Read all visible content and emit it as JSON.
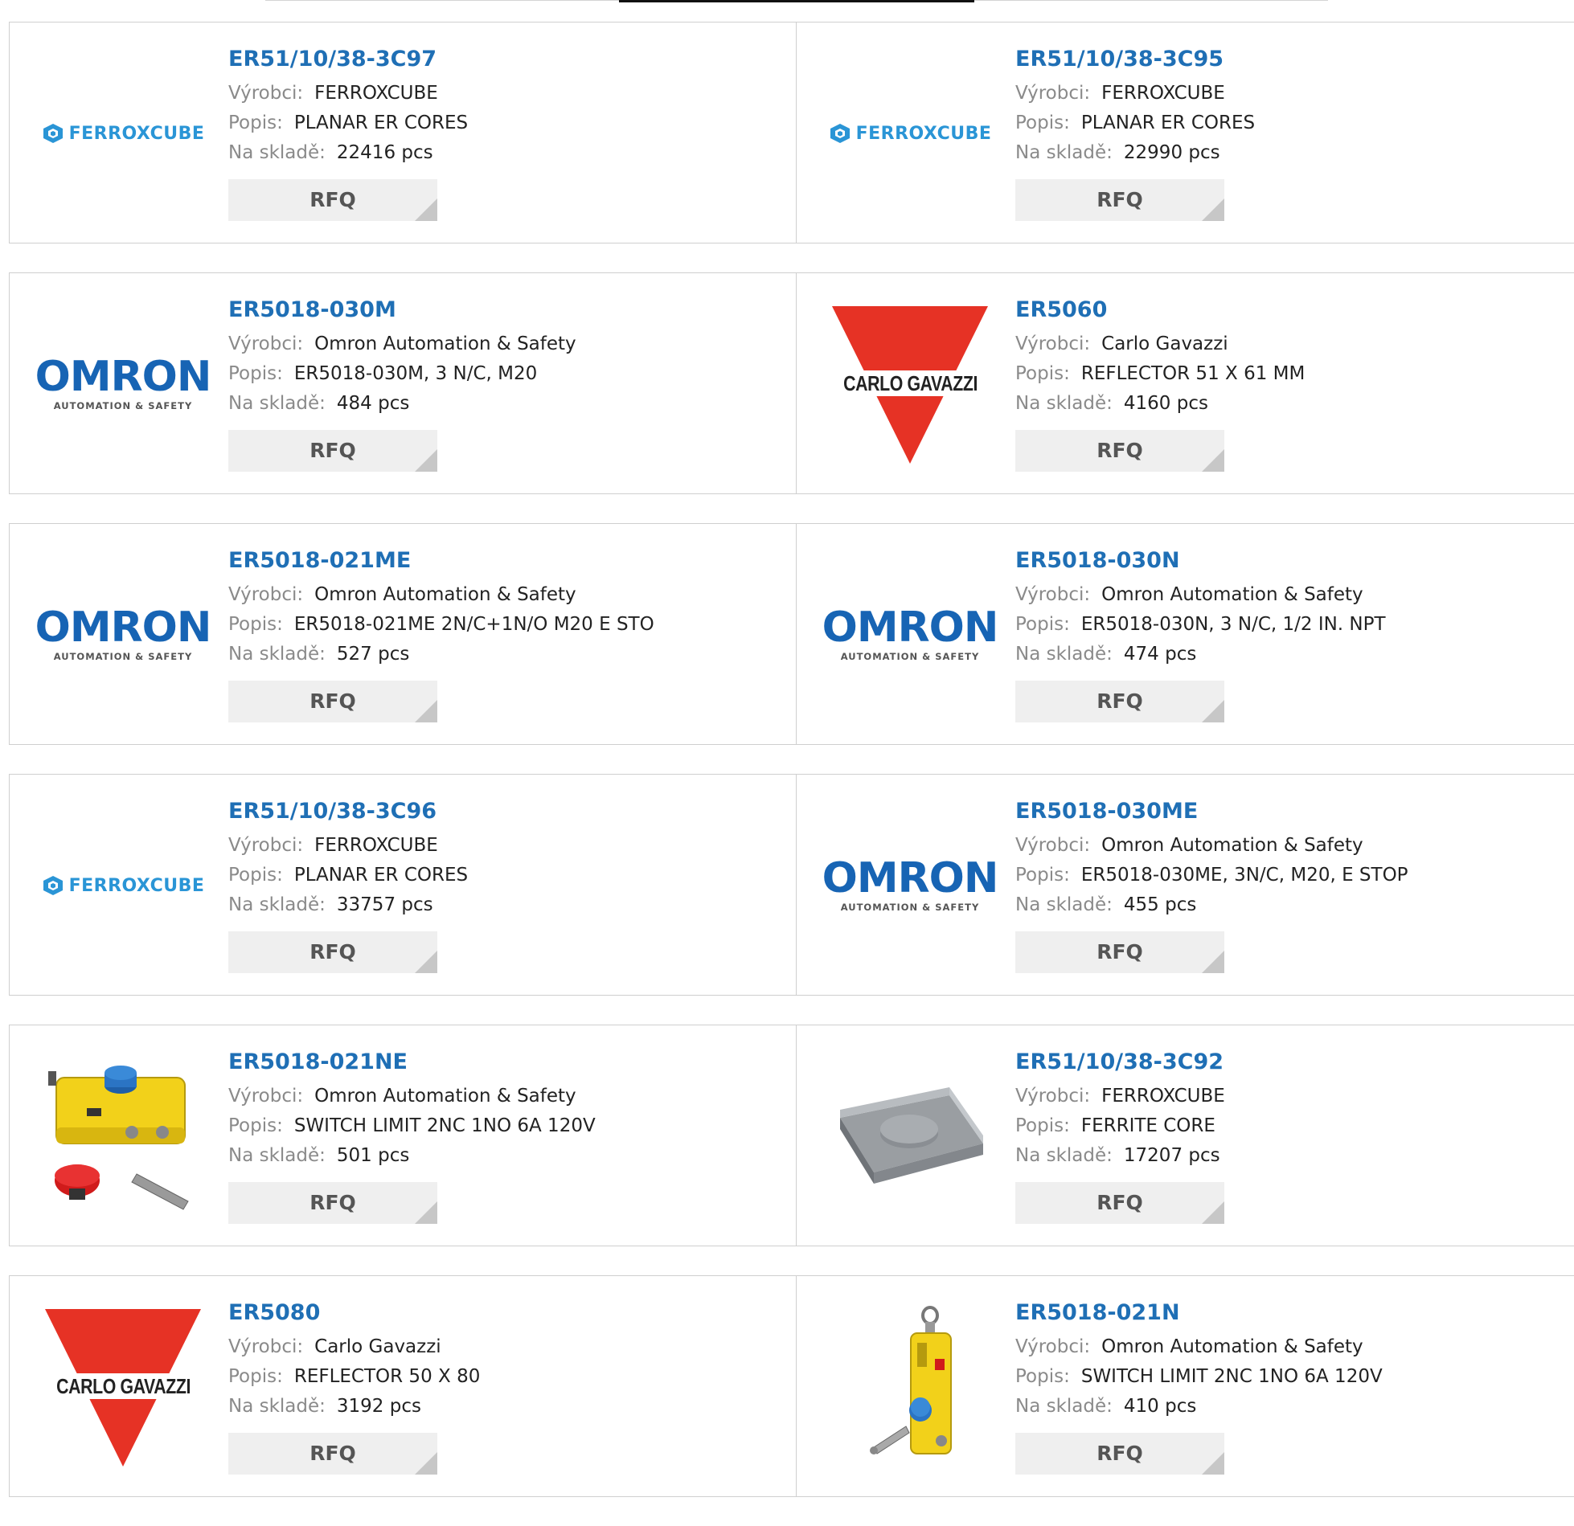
{
  "labels": {
    "manufacturer": "Výrobci:",
    "description": "Popis:",
    "stock": "Na skladě:",
    "rfq": "RFQ"
  },
  "brand_logos": {
    "ferroxcube": "FERROXCUBE",
    "omron": "OMRON",
    "omron_sub": "AUTOMATION & SAFETY",
    "carlo_gavazzi": "CARLO GAVAZZI"
  },
  "colors": {
    "link": "#1f6fb5",
    "ferroxcube_blue": "#2a95d6",
    "omron_blue": "#1764b4",
    "gavazzi_red": "#e63225",
    "rfq_bg": "#efefef"
  },
  "products": [
    {
      "pn": "ER51/10/38-3C97",
      "manufacturer": "FERROXCUBE",
      "description": "PLANAR ER CORES",
      "stock": "22416 pcs",
      "logo": "ferroxcube"
    },
    {
      "pn": "ER51/10/38-3C95",
      "manufacturer": "FERROXCUBE",
      "description": "PLANAR ER CORES",
      "stock": "22990 pcs",
      "logo": "ferroxcube"
    },
    {
      "pn": "ER5018-030M",
      "manufacturer": "Omron Automation & Safety",
      "description": "ER5018-030M, 3 N/C, M20",
      "stock": "484 pcs",
      "logo": "omron"
    },
    {
      "pn": "ER5060",
      "manufacturer": "Carlo Gavazzi",
      "description": "REFLECTOR 51 X 61 MM",
      "stock": "4160 pcs",
      "logo": "carlo-gavazzi"
    },
    {
      "pn": "ER5018-021ME",
      "manufacturer": "Omron Automation & Safety",
      "description": "ER5018-021ME 2N/C+1N/O M20 E STO",
      "stock": "527 pcs",
      "logo": "omron"
    },
    {
      "pn": "ER5018-030N",
      "manufacturer": "Omron Automation & Safety",
      "description": "ER5018-030N, 3 N/C, 1/2 IN. NPT",
      "stock": "474 pcs",
      "logo": "omron"
    },
    {
      "pn": "ER51/10/38-3C96",
      "manufacturer": "FERROXCUBE",
      "description": "PLANAR ER CORES",
      "stock": "33757 pcs",
      "logo": "ferroxcube"
    },
    {
      "pn": "ER5018-030ME",
      "manufacturer": "Omron Automation & Safety",
      "description": "ER5018-030ME, 3N/C, M20, E STOP",
      "stock": "455 pcs",
      "logo": "omron"
    },
    {
      "pn": "ER5018-021NE",
      "manufacturer": "Omron Automation & Safety",
      "description": "SWITCH LIMIT 2NC 1NO 6A 120V",
      "stock": "501 pcs",
      "logo": "switch-estop-photo"
    },
    {
      "pn": "ER51/10/38-3C92",
      "manufacturer": "FERROXCUBE",
      "description": "FERRITE CORE",
      "stock": "17207 pcs",
      "logo": "ferrite-core-photo"
    },
    {
      "pn": "ER5080",
      "manufacturer": "Carlo Gavazzi",
      "description": "REFLECTOR 50 X 80",
      "stock": "3192 pcs",
      "logo": "carlo-gavazzi"
    },
    {
      "pn": "ER5018-021N",
      "manufacturer": "Omron Automation & Safety",
      "description": "SWITCH LIMIT 2NC 1NO 6A 120V",
      "stock": "410 pcs",
      "logo": "switch-pull-photo"
    }
  ]
}
